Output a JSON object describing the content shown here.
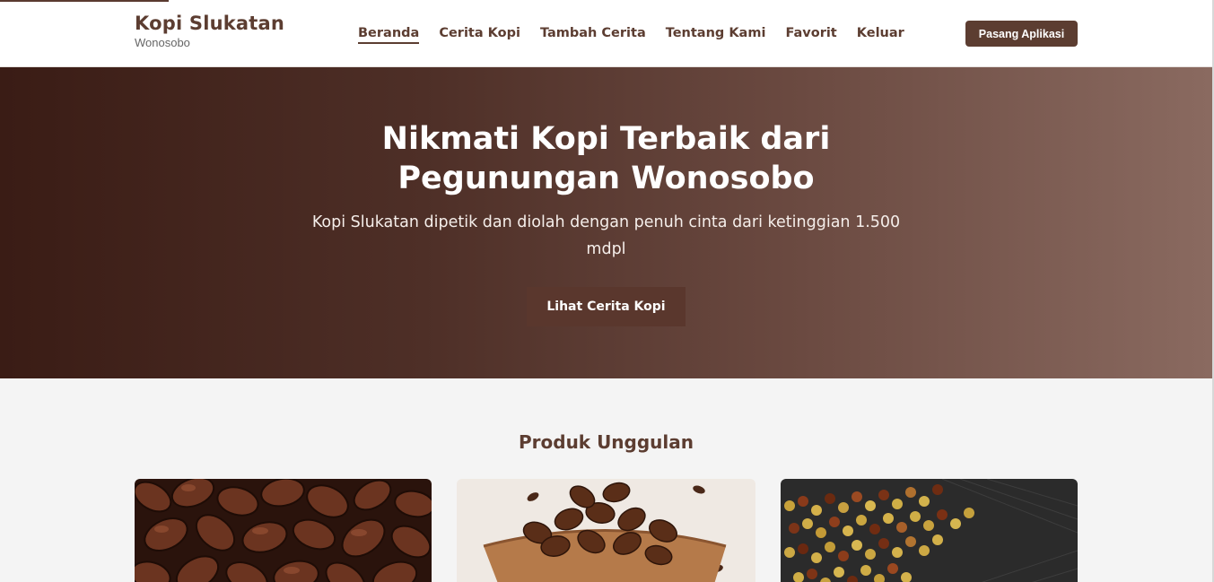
{
  "brand": {
    "title": "Kopi Slukatan",
    "subtitle": "Wonosobo"
  },
  "nav": {
    "items": [
      {
        "label": "Beranda",
        "active": true
      },
      {
        "label": "Cerita Kopi",
        "active": false
      },
      {
        "label": "Tambah Cerita",
        "active": false
      },
      {
        "label": "Tentang Kami",
        "active": false
      },
      {
        "label": "Favorit",
        "active": false
      },
      {
        "label": "Keluar",
        "active": false
      }
    ],
    "install_label": "Pasang Aplikasi"
  },
  "hero": {
    "title": "Nikmati Kopi Terbaik dari Pegunungan Wonosobo",
    "subtitle": "Kopi Slukatan dipetik dan diolah dengan penuh cinta dari ketinggian 1.500 mdpl",
    "button_label": "Lihat Cerita Kopi"
  },
  "products": {
    "heading": "Produk Unggulan",
    "cards": [
      {
        "image": "roasted-coffee-beans-closeup"
      },
      {
        "image": "coffee-beans-in-wooden-bowl"
      },
      {
        "image": "coffee-cherries-drying"
      }
    ]
  },
  "colors": {
    "brand": "#5c3d31",
    "hero_gradient_start": "#3a1c15",
    "hero_gradient_end": "#8a6a60",
    "page_bg": "#f4f4f4"
  }
}
